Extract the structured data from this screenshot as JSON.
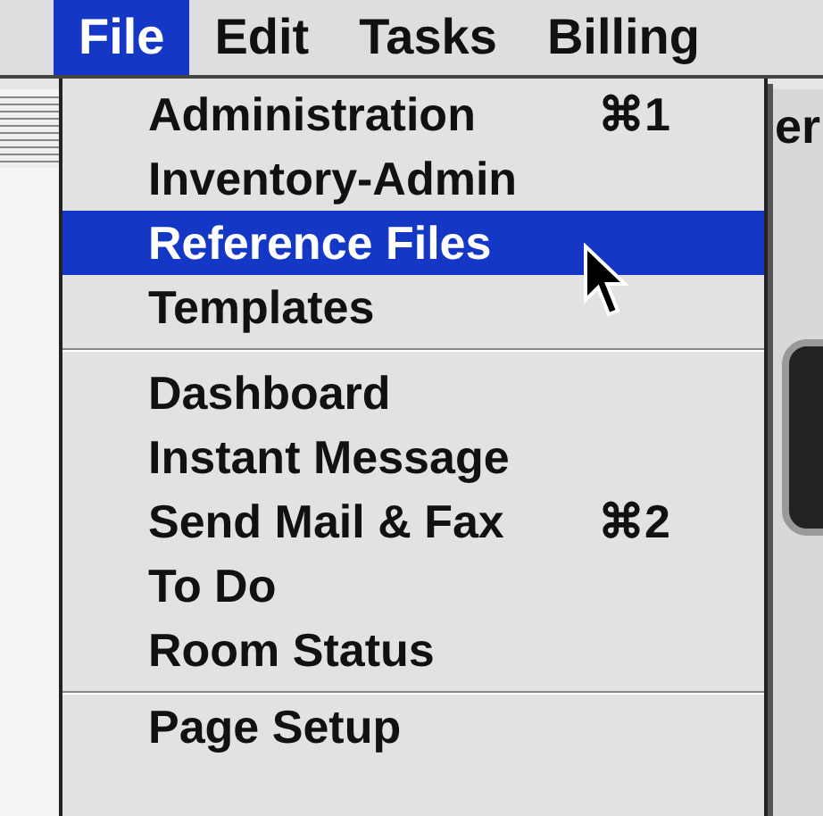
{
  "menu_bar": [
    {
      "label": "File",
      "selected": true
    },
    {
      "label": "Edit",
      "selected": false
    },
    {
      "label": "Tasks",
      "selected": false
    },
    {
      "label": "Billing",
      "selected": false
    }
  ],
  "background_text": "er",
  "file_menu": [
    {
      "kind": "item",
      "label": "Administration",
      "shortcut": "⌘1",
      "selected": false
    },
    {
      "kind": "item",
      "label": "Inventory-Admin",
      "selected": false
    },
    {
      "kind": "item",
      "label": "Reference Files",
      "selected": true
    },
    {
      "kind": "item",
      "label": "Templates",
      "selected": false
    },
    {
      "kind": "separator"
    },
    {
      "kind": "item",
      "label": "Dashboard",
      "selected": false
    },
    {
      "kind": "item",
      "label": "Instant Message",
      "selected": false
    },
    {
      "kind": "item",
      "label": "Send Mail & Fax",
      "shortcut": "⌘2",
      "selected": false
    },
    {
      "kind": "item",
      "label": "To Do",
      "selected": false
    },
    {
      "kind": "item",
      "label": "Room Status",
      "selected": false
    },
    {
      "kind": "separator"
    },
    {
      "kind": "item",
      "label": "Page Setup",
      "selected": false
    }
  ]
}
